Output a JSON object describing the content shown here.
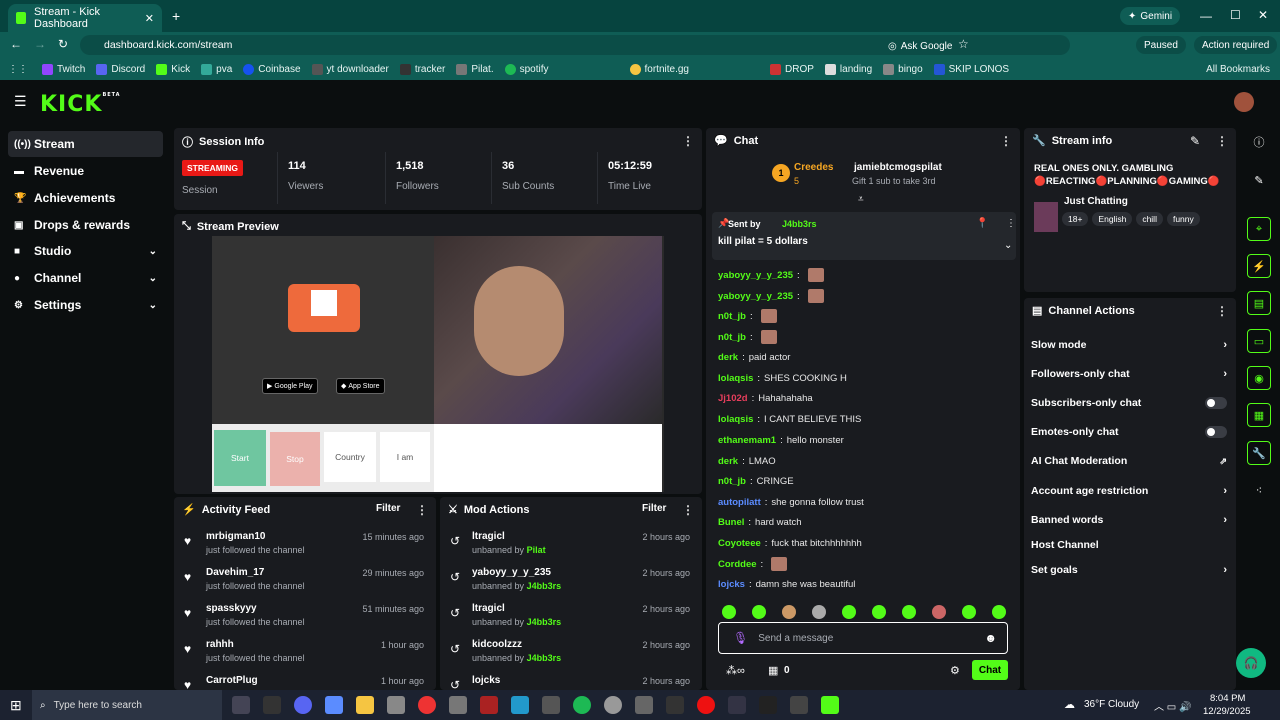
{
  "browser": {
    "tab_title": "Stream - Kick Dashboard",
    "url": "dashboard.kick.com/stream",
    "gemini_label": "Gemini",
    "ask_google": "Ask Google",
    "paused_label": "Paused",
    "action_required": "Action required",
    "bookmarks": [
      "Twitch",
      "Discord",
      "Kick",
      "pva",
      "Coinbase",
      "yt downloader",
      "tracker",
      "Pilat.",
      "spotify",
      "fortnite.gg",
      "DROP",
      "landing",
      "bingo",
      "SKIP LONOS"
    ],
    "all_bookmarks": "All Bookmarks"
  },
  "header": {
    "logo": "KICK",
    "logo_sup": "BETA"
  },
  "sidebar": {
    "items": [
      {
        "label": "Stream",
        "icon": "radio-icon"
      },
      {
        "label": "Revenue",
        "icon": "revenue-icon"
      },
      {
        "label": "Achievements",
        "icon": "trophy-icon"
      },
      {
        "label": "Drops & rewards",
        "icon": "gift-icon"
      },
      {
        "label": "Studio",
        "icon": "studio-icon"
      },
      {
        "label": "Channel",
        "icon": "channel-icon"
      },
      {
        "label": "Settings",
        "icon": "gear-icon"
      }
    ]
  },
  "session": {
    "title": "Session Info",
    "status": "STREAMING",
    "status_label": "Session",
    "stats": [
      {
        "value": "114",
        "label": "Viewers"
      },
      {
        "value": "1,518",
        "label": "Followers"
      },
      {
        "value": "36",
        "label": "Sub Counts"
      },
      {
        "value": "05:12:59",
        "label": "Time Live"
      }
    ]
  },
  "preview": {
    "title": "Stream Preview",
    "google_play": "Google Play",
    "app_store": "App Store",
    "btn_start": "Start",
    "btn_stop": "Stop",
    "btn_country": "Country",
    "btn_iam": "I am"
  },
  "activity": {
    "title": "Activity Feed",
    "filter": "Filter",
    "items": [
      {
        "name": "mrbigman10",
        "sub": "just followed the channel",
        "time": "15 minutes ago"
      },
      {
        "name": "Davehim_17",
        "sub": "just followed the channel",
        "time": "29 minutes ago"
      },
      {
        "name": "spasskyyy",
        "sub": "just followed the channel",
        "time": "51 minutes ago"
      },
      {
        "name": "rahhh",
        "sub": "just followed the channel",
        "time": "1 hour ago"
      },
      {
        "name": "CarrotPlug",
        "sub": "",
        "time": "1 hour ago"
      }
    ]
  },
  "mod": {
    "title": "Mod Actions",
    "filter": "Filter",
    "items": [
      {
        "name": "ltragicl",
        "action": "unbanned by",
        "by": "Pilat",
        "time": "2 hours ago"
      },
      {
        "name": "yaboyy_y_y_235",
        "action": "unbanned by",
        "by": "J4bb3rs",
        "time": "2 hours ago"
      },
      {
        "name": "ltragicl",
        "action": "unbanned by",
        "by": "J4bb3rs",
        "time": "2 hours ago"
      },
      {
        "name": "kidcoolzzz",
        "action": "unbanned by",
        "by": "J4bb3rs",
        "time": "2 hours ago"
      },
      {
        "name": "lojcks",
        "action": "",
        "by": "",
        "time": "2 hours ago"
      }
    ]
  },
  "chat": {
    "title": "Chat",
    "top_gifter": "Creedes",
    "top_gifter_count": "5",
    "top_rank": "1",
    "gift_user": "jamiebtcmogspilat",
    "gift_text": "Gift 1 sub to take 3rd",
    "pinned_sent_by": "Sent by",
    "pinned_user": "J4bb3rs",
    "pinned_msg": "kill pilat = 5 dollars",
    "messages": [
      {
        "user": "yaboyy_y_y_235",
        "text": "",
        "color": "#53fc18"
      },
      {
        "user": "yaboyy_y_y_235",
        "text": "",
        "color": "#53fc18"
      },
      {
        "user": "n0t_jb",
        "text": "",
        "color": "#53fc18"
      },
      {
        "user": "n0t_jb",
        "text": "",
        "color": "#53fc18"
      },
      {
        "user": "derk",
        "text": "paid actor",
        "color": "#53fc18"
      },
      {
        "user": "lolaqsis",
        "text": "SHES COOKING H",
        "color": "#53fc18"
      },
      {
        "user": "Jj102d",
        "text": "Hahahahaha",
        "color": "#e63e5c"
      },
      {
        "user": "lolaqsis",
        "text": "I CANT BELIEVE THIS",
        "color": "#53fc18"
      },
      {
        "user": "ethanemam1",
        "text": "hello monster",
        "color": "#53fc18"
      },
      {
        "user": "derk",
        "text": "LMAO",
        "color": "#53fc18"
      },
      {
        "user": "n0t_jb",
        "text": "CRINGE",
        "color": "#53fc18"
      },
      {
        "user": "autopilatt",
        "text": "she gonna follow trust",
        "color": "#5b8cff"
      },
      {
        "user": "Bunel",
        "text": "hard watch",
        "color": "#53fc18"
      },
      {
        "user": "Coyoteee",
        "text": "fuck that bitchhhhhhh",
        "color": "#53fc18"
      },
      {
        "user": "Corddee",
        "text": "",
        "color": "#53fc18"
      },
      {
        "user": "lojcks",
        "text": "damn she was beautiful",
        "color": "#5b8cff"
      }
    ],
    "input_placeholder": "Send a message",
    "points": "0",
    "send_label": "Chat"
  },
  "stream_info": {
    "title": "Stream info",
    "stream_title": "REAL ONES ONLY. GAMBLING 🔴REACTING🔴PLANNING🔴GAMING🔴",
    "category": "Just Chatting",
    "tags": [
      "18+",
      "English",
      "chill",
      "funny"
    ]
  },
  "channel_actions": {
    "title": "Channel Actions",
    "items": [
      {
        "label": "Slow mode",
        "control": "chevron"
      },
      {
        "label": "Followers-only chat",
        "control": "chevron"
      },
      {
        "label": "Subscribers-only chat",
        "control": "toggle"
      },
      {
        "label": "Emotes-only chat",
        "control": "toggle"
      },
      {
        "label": "AI Chat Moderation",
        "control": "chart"
      },
      {
        "label": "Account age restriction",
        "control": "chevron"
      },
      {
        "label": "Banned words",
        "control": "chevron"
      },
      {
        "label": "Host Channel",
        "control": "none"
      },
      {
        "label": "Set goals",
        "control": "chevron"
      }
    ]
  },
  "taskbar": {
    "search_placeholder": "Type here to search",
    "weather": "36°F  Cloudy",
    "time": "8:04 PM",
    "date": "12/29/2025"
  },
  "colors": {
    "accent": "#53fc18",
    "panel": "#191b1f",
    "bg": "#0b0e0f",
    "live": "#e91916"
  }
}
